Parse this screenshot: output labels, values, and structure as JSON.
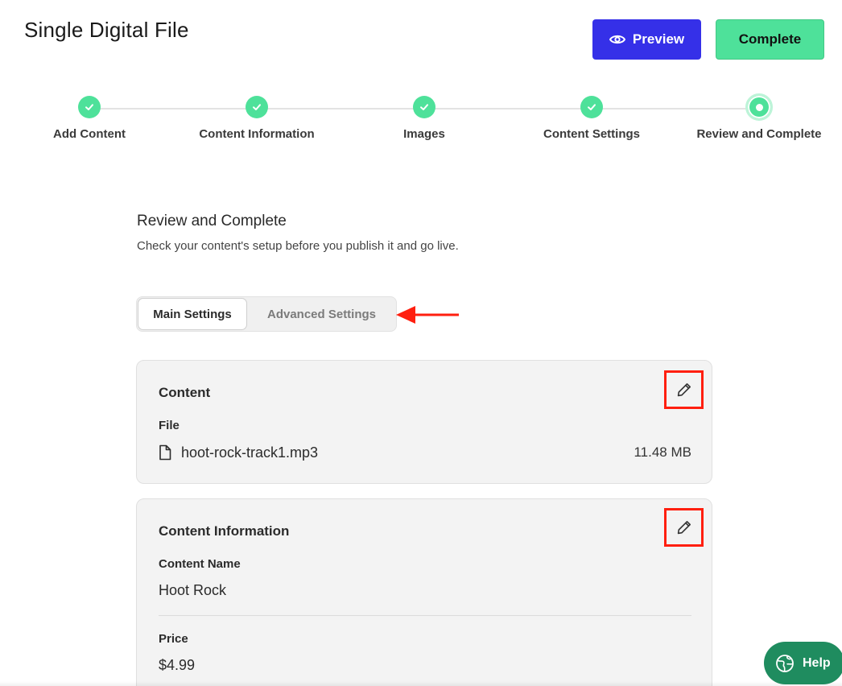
{
  "header": {
    "title": "Single Digital File",
    "preview_label": "Preview",
    "complete_label": "Complete"
  },
  "stepper": {
    "steps": [
      {
        "label": "Add Content",
        "status": "done"
      },
      {
        "label": "Content Information",
        "status": "done"
      },
      {
        "label": "Images",
        "status": "done"
      },
      {
        "label": "Content Settings",
        "status": "done"
      },
      {
        "label": "Review and Complete",
        "status": "current"
      }
    ]
  },
  "main": {
    "title": "Review and Complete",
    "subtitle": "Check your content's setup before you publish it and go live.",
    "tabs": [
      {
        "label": "Main Settings",
        "active": true
      },
      {
        "label": "Advanced Settings",
        "active": false
      }
    ]
  },
  "content_card": {
    "title": "Content",
    "file_label": "File",
    "file_name": "hoot-rock-track1.mp3",
    "file_size": "11.48 MB"
  },
  "info_card": {
    "title": "Content Information",
    "name_label": "Content Name",
    "name_value": "Hoot Rock",
    "price_label": "Price",
    "price_value": "$4.99"
  },
  "help": {
    "label": "Help"
  },
  "icons": {
    "preview": "eye-icon",
    "step_done": "check-icon",
    "edit": "pencil-icon",
    "file": "file-icon",
    "help": "globe-icon"
  },
  "colors": {
    "primary": "#3530e8",
    "success": "#4ee19a",
    "help_bg": "#1f8c5f",
    "annotation": "#ff1f0f"
  }
}
